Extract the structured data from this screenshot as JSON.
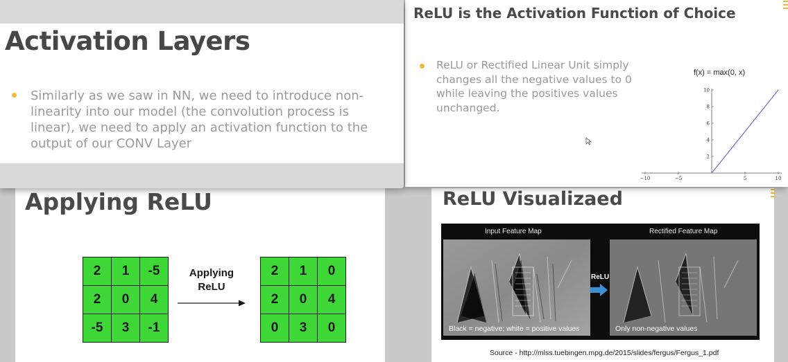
{
  "slide1": {
    "title": "Activation Layers",
    "bullet": "Similarly as we saw in NN, we need to introduce non-linearity into our model (the convolution process is linear), we need to apply an activation function to the output of our CONV Layer"
  },
  "slide2": {
    "title": "ReLU is the Activation Function of Choice",
    "bullet": "ReLU or Rectified Linear Unit simply changes all the negative values to 0 while leaving the positives values unchanged.",
    "plot": {
      "title": "f(x) = max(0, x)",
      "xticks": [
        "−10",
        "−5",
        "5",
        "10"
      ],
      "yticks": [
        "2",
        "4",
        "6",
        "8",
        "10"
      ]
    }
  },
  "slide3": {
    "title": "Applying ReLU",
    "apply_label_line1": "Applying",
    "apply_label_line2": "ReLU",
    "input_grid": [
      "2",
      "1",
      "-5",
      "2",
      "0",
      "4",
      "-5",
      "3",
      "-1"
    ],
    "output_grid": [
      "2",
      "1",
      "0",
      "2",
      "0",
      "4",
      "0",
      "3",
      "0"
    ]
  },
  "slide4": {
    "title": "ReLU Visualizaed",
    "input_label": "Input Feature Map",
    "output_label": "Rectified Feature Map",
    "relu_label": "ReLU",
    "input_caption": "Black = negative; white = positive values",
    "output_caption": "Only non-negative values",
    "source": "Source - http://mlss.tuebingen.mpg.de/2015/slides/fergus/Fergus_1.pdf"
  },
  "colors": {
    "accent_bullet": "#f3b93a",
    "grid_green": "#3fd637",
    "relu_arrow": "#3a8fd6"
  }
}
